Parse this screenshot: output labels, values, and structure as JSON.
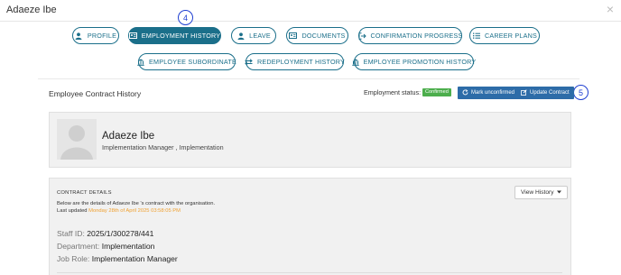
{
  "window": {
    "title": "Adaeze Ibe",
    "close_glyph": "×"
  },
  "nav": {
    "row1": [
      {
        "label": "PROFILE",
        "icon": "user-icon"
      },
      {
        "label": "EMPLOYMENT HISTORY",
        "icon": "id-card-icon",
        "active": true
      },
      {
        "label": "LEAVE",
        "icon": "user-icon"
      },
      {
        "label": "DOCUMENTS",
        "icon": "id-card-icon"
      },
      {
        "label": "CONFIRMATION PROGRESS",
        "icon": "sign-out-icon"
      },
      {
        "label": "CAREER PLANS",
        "icon": "list-icon"
      }
    ],
    "row2": [
      {
        "label": "EMPLOYEE SUBORDINATE",
        "icon": "building-icon"
      },
      {
        "label": "REDEPLOYMENT HISTORY",
        "icon": "swap-icon"
      },
      {
        "label": "EMPLOYEE PROMOTION HISTORY",
        "icon": "building-icon"
      }
    ]
  },
  "markers": {
    "nav_marker": "4",
    "update_marker": "5"
  },
  "section": {
    "title": "Employee Contract History",
    "employment_status_label": "Employment status:",
    "status_badge": "Confirmed",
    "mark_unconfirmed_label": "Mark unconfirmed",
    "update_contract_label": "Update Contract"
  },
  "profile": {
    "name": "Adaeze Ibe",
    "role": "Implementation Manager , Implementation"
  },
  "contract_details": {
    "title": "CONTRACT DETAILS",
    "description": "Below are the details of Adaeze Ibe 's contract with the organisation.",
    "last_updated_label": "Last updated",
    "last_updated_value": "Monday 28th of April 2025 03:58:05 PM",
    "view_history_label": "View History",
    "staff_id_label": "Staff ID:",
    "staff_id_value": "2025/1/300278/441",
    "department_label": "Department:",
    "department_value": "Implementation",
    "job_role_label": "Job Role:",
    "job_role_value": "Implementation Manager"
  },
  "colors": {
    "primary": "#1b6f8a",
    "button_blue": "#2d6ca8",
    "success": "#4cae4c",
    "highlight": "#f0a030",
    "marker": "#1f3fd1"
  }
}
